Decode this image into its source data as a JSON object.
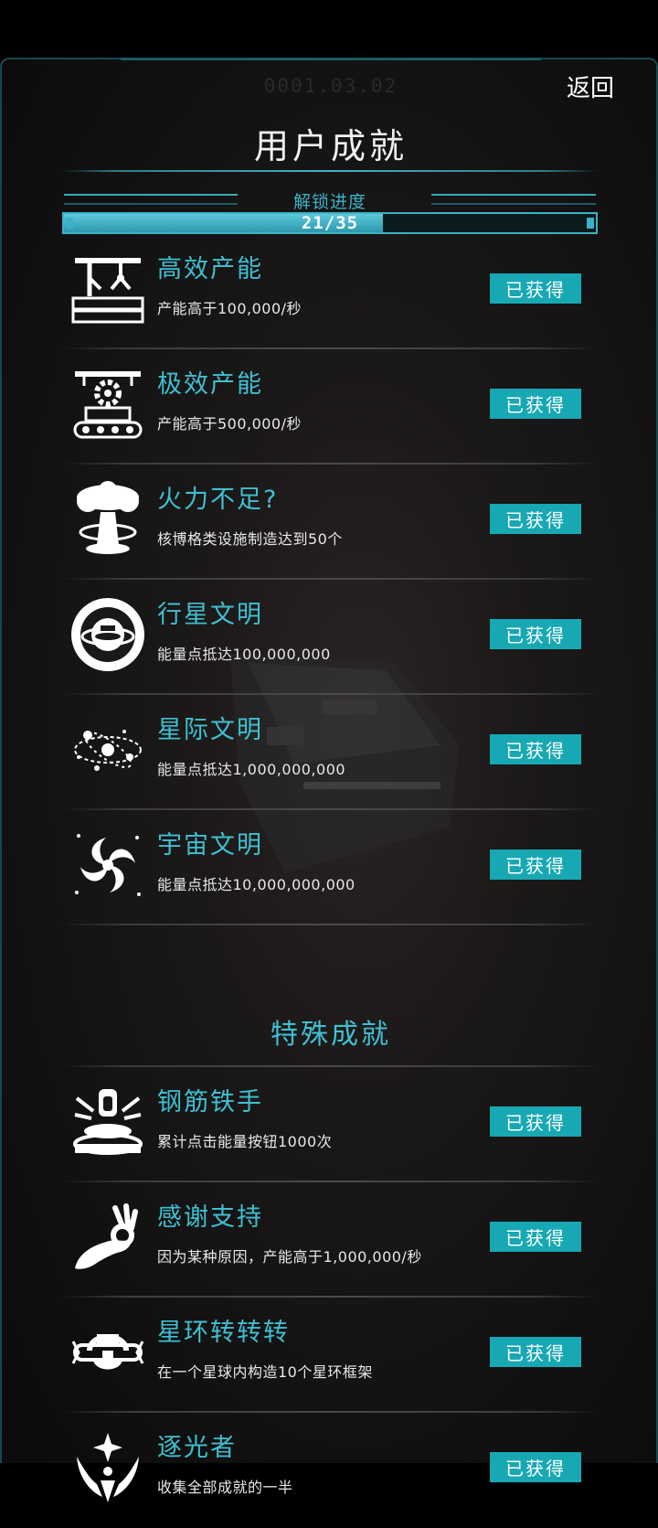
{
  "header": {
    "version": "0001.03.02",
    "back_label": "返回",
    "title": "用户成就"
  },
  "progress": {
    "label": "解锁进度",
    "text": "21/35",
    "unlocked": 21,
    "total": 35
  },
  "achievements": [
    {
      "name": "高效产能",
      "desc": "产能高于100,000/秒",
      "badge": "已获得",
      "icon": "factory-arm-icon"
    },
    {
      "name": "极效产能",
      "desc": "产能高于500,000/秒",
      "badge": "已获得",
      "icon": "conveyor-gear-icon"
    },
    {
      "name": "火力不足?",
      "desc": "核博格类设施制造达到50个",
      "badge": "已获得",
      "icon": "mushroom-cloud-icon"
    },
    {
      "name": "行星文明",
      "desc": "能量点抵达100,000,000",
      "badge": "已获得",
      "icon": "planet-civilization-icon"
    },
    {
      "name": "星际文明",
      "desc": "能量点抵达1,000,000,000",
      "badge": "已获得",
      "icon": "star-system-icon"
    },
    {
      "name": "宇宙文明",
      "desc": "能量点抵达10,000,000,000",
      "badge": "已获得",
      "icon": "spiral-galaxy-icon"
    }
  ],
  "special_section": {
    "title": "特殊成就"
  },
  "special_achievements": [
    {
      "name": "钢筋铁手",
      "desc": "累计点击能量按钮1000次",
      "badge": "已获得",
      "icon": "press-button-icon"
    },
    {
      "name": "感谢支持",
      "desc": "因为某种原因，产能高于1,000,000/秒",
      "badge": "已获得",
      "icon": "ok-hand-icon"
    },
    {
      "name": "星环转转转",
      "desc": "在一个星球内构造10个星环框架",
      "badge": "已获得",
      "icon": "star-ring-icon"
    },
    {
      "name": "逐光者",
      "desc": "收集全部成就的一半",
      "badge": "已获得",
      "icon": "light-chaser-icon"
    }
  ],
  "colors": {
    "accent": "#3ec0d2",
    "badge_bg": "#17a8b3",
    "progress_fill": "#2b98ad"
  }
}
